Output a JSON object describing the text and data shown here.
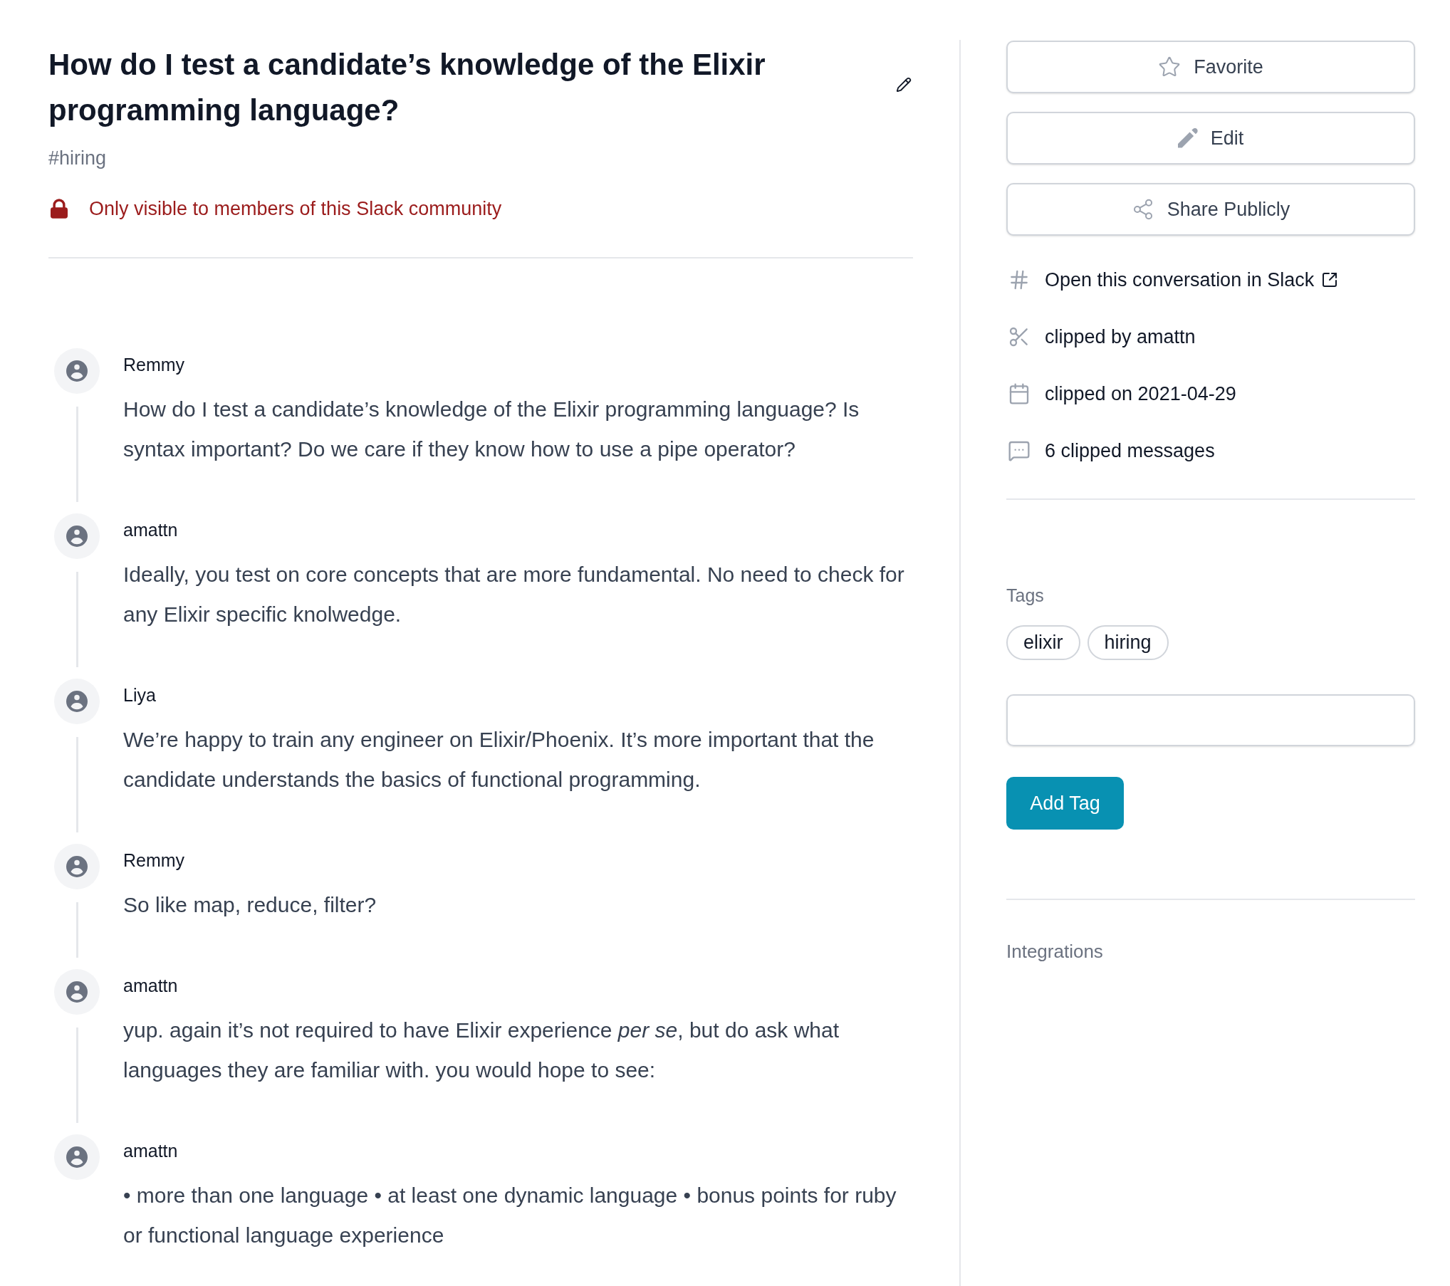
{
  "post": {
    "title": "How do I test a candidate’s knowledge of the Elixir programming language?",
    "channel": "#hiring",
    "visibility": "Only visible to members of this Slack community"
  },
  "messages": [
    {
      "author": "Remmy",
      "text": "How do I test a candidate’s knowledge of the Elixir programming language? Is syntax important? Do we care if they know how to use a pipe operator?"
    },
    {
      "author": "amattn",
      "text": "Ideally, you test on core concepts that are more fundamental. No need to check for any Elixir specific knolwedge."
    },
    {
      "author": "Liya",
      "text": "We’re happy to train any engineer on Elixir/Phoenix. It’s more important that the candidate understands the basics of functional programming."
    },
    {
      "author": "Remmy",
      "text": "So like map, reduce, filter?"
    },
    {
      "author": "amattn",
      "text": "yup. again it’s not required to have Elixir experience *per se*, but do ask what languages they are familiar with. you would hope to see:"
    },
    {
      "author": "amattn",
      "text": "• more than one language • at least one dynamic language • bonus points for ruby or functional language experience"
    }
  ],
  "sidebar": {
    "actions": [
      {
        "kind": "favorite",
        "label": "Favorite"
      },
      {
        "kind": "edit",
        "label": "Edit"
      },
      {
        "kind": "share",
        "label": "Share Publicly"
      }
    ],
    "details": [
      {
        "kind": "slack_link",
        "text": "Open this conversation in Slack"
      },
      {
        "kind": "clipped_by",
        "text": "clipped by amattn"
      },
      {
        "kind": "clipped_on",
        "text": "clipped on 2021-04-29"
      },
      {
        "kind": "message_count",
        "text": "6 clipped messages"
      }
    ],
    "tags": {
      "label": "Tags",
      "items": [
        "elixir",
        "hiring"
      ],
      "add_button": "Add Tag"
    },
    "integrations": {
      "label": "Integrations"
    }
  }
}
